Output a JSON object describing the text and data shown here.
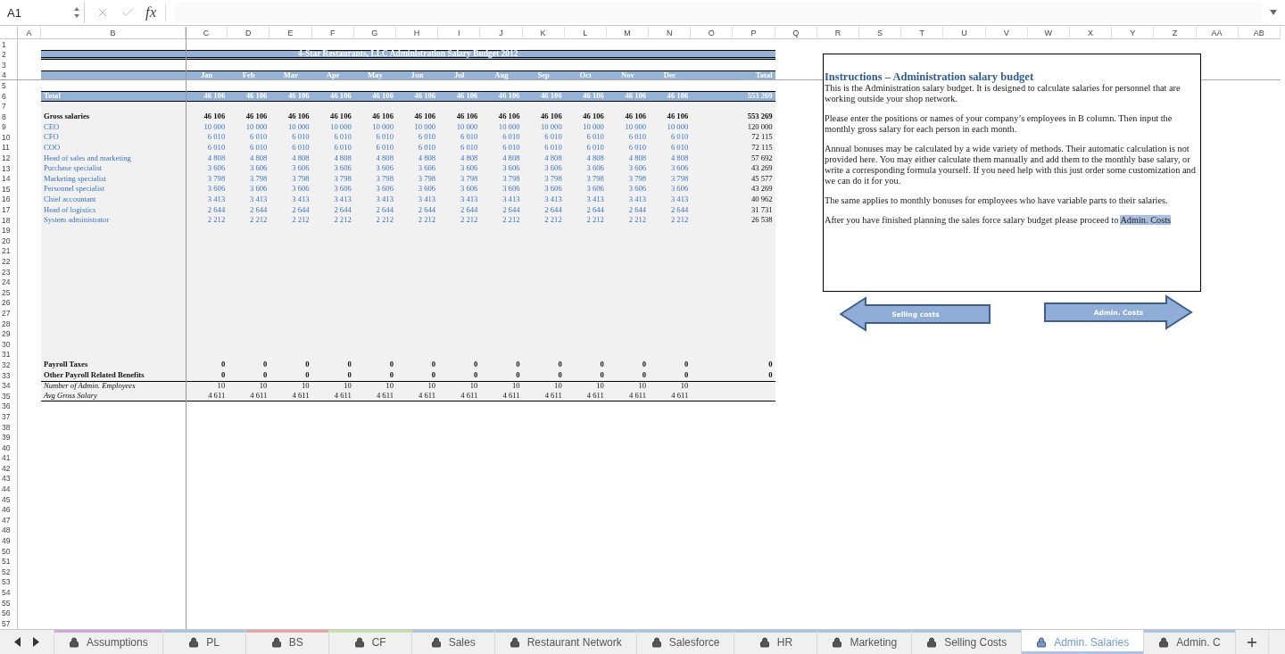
{
  "formula_bar": {
    "cell_ref": "A1",
    "function_symbol": "fx"
  },
  "columns": [
    "A",
    "B",
    "C",
    "D",
    "E",
    "F",
    "G",
    "H",
    "I",
    "J",
    "K",
    "L",
    "M",
    "N",
    "O",
    "P",
    "Q",
    "R",
    "S",
    "T",
    "U",
    "V",
    "W",
    "X",
    "Y",
    "Z",
    "AA",
    "AB"
  ],
  "row_numbers": [
    "1",
    "2",
    "3",
    "4",
    "5",
    "6",
    "7",
    "8",
    "9",
    "10",
    "11",
    "12",
    "13",
    "14",
    "15",
    "16",
    "17",
    "18",
    "19",
    "20",
    "21",
    "22",
    "23",
    "24",
    "25",
    "26",
    "27",
    "28",
    "29",
    "30",
    "31",
    "32",
    "33",
    "34",
    "35",
    "36",
    "37",
    "38",
    "39",
    "40",
    "41",
    "42",
    "43",
    "44",
    "45",
    "46",
    "47",
    "48",
    "49",
    "50",
    "51",
    "52",
    "53",
    "54",
    "55",
    "56",
    "57"
  ],
  "budget": {
    "title": "4-Star Restaurants, LLC Administration Salary Budget 2012",
    "months": [
      "Jan",
      "Feb",
      "Mar",
      "Apr",
      "May",
      "Jun",
      "Jul",
      "Aug",
      "Sep",
      "Oct",
      "Nov",
      "Dec"
    ],
    "total_header": "Total",
    "total_row": {
      "label": "Total",
      "values": [
        "46 106",
        "46 106",
        "46 106",
        "46 106",
        "46 106",
        "46 106",
        "46 106",
        "46 106",
        "46 106",
        "46 106",
        "46 106",
        "46 106"
      ],
      "total": "553 269"
    },
    "salary_rows": [
      {
        "kind": "bold",
        "label": "Gross salaries",
        "values": [
          "46 106",
          "46 106",
          "46 106",
          "46 106",
          "46 106",
          "46 106",
          "46 106",
          "46 106",
          "46 106",
          "46 106",
          "46 106",
          "46 106"
        ],
        "total": "553 269"
      },
      {
        "kind": "input",
        "label": "CEO",
        "values": [
          "10 000",
          "10 000",
          "10 000",
          "10 000",
          "10 000",
          "10 000",
          "10 000",
          "10 000",
          "10 000",
          "10 000",
          "10 000",
          "10 000"
        ],
        "total": "120 000"
      },
      {
        "kind": "input",
        "label": "CFO",
        "values": [
          "6 010",
          "6 010",
          "6 010",
          "6 010",
          "6 010",
          "6 010",
          "6 010",
          "6 010",
          "6 010",
          "6 010",
          "6 010",
          "6 010"
        ],
        "total": "72 115"
      },
      {
        "kind": "input",
        "label": "COO",
        "values": [
          "6 010",
          "6 010",
          "6 010",
          "6 010",
          "6 010",
          "6 010",
          "6 010",
          "6 010",
          "6 010",
          "6 010",
          "6 010",
          "6 010"
        ],
        "total": "72 115"
      },
      {
        "kind": "input",
        "label": "Head of sales and marketing",
        "values": [
          "4 808",
          "4 808",
          "4 808",
          "4 808",
          "4 808",
          "4 808",
          "4 808",
          "4 808",
          "4 808",
          "4 808",
          "4 808",
          "4 808"
        ],
        "total": "57 692"
      },
      {
        "kind": "input",
        "label": "Purchase specialist",
        "values": [
          "3 606",
          "3 606",
          "3 606",
          "3 606",
          "3 606",
          "3 606",
          "3 606",
          "3 606",
          "3 606",
          "3 606",
          "3 606",
          "3 606"
        ],
        "total": "43 269"
      },
      {
        "kind": "input",
        "label": "Marketing specialist",
        "values": [
          "3 798",
          "3 798",
          "3 798",
          "3 798",
          "3 798",
          "3 798",
          "3 798",
          "3 798",
          "3 798",
          "3 798",
          "3 798",
          "3 798"
        ],
        "total": "45 577"
      },
      {
        "kind": "input",
        "label": "Personnel specialist",
        "values": [
          "3 606",
          "3 606",
          "3 606",
          "3 606",
          "3 606",
          "3 606",
          "3 606",
          "3 606",
          "3 606",
          "3 606",
          "3 606",
          "3 606"
        ],
        "total": "43 269"
      },
      {
        "kind": "input",
        "label": "Chief accountant",
        "values": [
          "3 413",
          "3 413",
          "3 413",
          "3 413",
          "3 413",
          "3 413",
          "3 413",
          "3 413",
          "3 413",
          "3 413",
          "3 413",
          "3 413"
        ],
        "total": "40 962"
      },
      {
        "kind": "input",
        "label": "Head of logistics",
        "values": [
          "2 644",
          "2 644",
          "2 644",
          "2 644",
          "2 644",
          "2 644",
          "2 644",
          "2 644",
          "2 644",
          "2 644",
          "2 644",
          "2 644"
        ],
        "total": "31 731"
      },
      {
        "kind": "input",
        "label": "System administrator",
        "values": [
          "2 212",
          "2 212",
          "2 212",
          "2 212",
          "2 212",
          "2 212",
          "2 212",
          "2 212",
          "2 212",
          "2 212",
          "2 212",
          "2 212"
        ],
        "total": "26 538"
      }
    ],
    "footer_rows": [
      {
        "kind": "bold",
        "label": "Payroll Taxes",
        "values": [
          "0",
          "0",
          "0",
          "0",
          "0",
          "0",
          "0",
          "0",
          "0",
          "0",
          "0",
          "0"
        ],
        "total": "0"
      },
      {
        "kind": "bold",
        "label": "Other Payroll Related Benefits",
        "values": [
          "0",
          "0",
          "0",
          "0",
          "0",
          "0",
          "0",
          "0",
          "0",
          "0",
          "0",
          "0"
        ],
        "total": "0"
      },
      {
        "kind": "italic",
        "label": "Number of Admin. Employees",
        "values": [
          "10",
          "10",
          "10",
          "10",
          "10",
          "10",
          "10",
          "10",
          "10",
          "10",
          "10",
          "10"
        ]
      },
      {
        "kind": "italic",
        "label": "Avg Gross Salary",
        "values": [
          "4 611",
          "4 611",
          "4 611",
          "4 611",
          "4 611",
          "4 611",
          "4 611",
          "4 611",
          "4 611",
          "4 611",
          "4 611",
          "4 611"
        ]
      }
    ]
  },
  "instructions": {
    "title": "Instructions – Administration salary budget",
    "paragraphs": [
      "This is the Administration salary budget. It is designed to calculate salaries for personnel that are working outside your shop network.",
      "Please enter the positions or names of your company’s employees in B column. Then input the monthly gross salary for each person in each month.",
      "Annual bonuses may be calculated by a wide variety of methods. Their automatic calculation is not provided here. You may either calculate them manually and add them to the monthly base salary, or write a corresponding formula yourself. If you need help with this just order some customization and we can do it for you.",
      "The same applies to monthly bonuses for employees who have variable parts to their salaries."
    ],
    "closing": "After you have finished planning the sales force salary budget please proceed to",
    "closing_link": "Admin. Costs"
  },
  "nav_buttons": [
    {
      "kind": "back",
      "label": "Selling costs"
    },
    {
      "kind": "forward",
      "label": "Admin. Costs"
    }
  ],
  "sheet_tabs": [
    {
      "label": "Assumptions",
      "selected": false,
      "color": "#cfa9d8"
    },
    {
      "label": "PL",
      "selected": false,
      "color": "#aec3e2"
    },
    {
      "label": "BS",
      "selected": false,
      "color": "#e8a4a4"
    },
    {
      "label": "CF",
      "selected": false,
      "color": "#c7e0a8"
    },
    {
      "label": "Sales",
      "selected": false,
      "color": "#aec3e2"
    },
    {
      "label": "Restaurant Network",
      "selected": false,
      "color": "#aec3e2"
    },
    {
      "label": "Salesforce",
      "selected": false,
      "color": "#aec3e2"
    },
    {
      "label": "HR",
      "selected": false,
      "color": "#aec3e2"
    },
    {
      "label": "Marketing",
      "selected": false,
      "color": "#aec3e2"
    },
    {
      "label": "Selling Costs",
      "selected": false,
      "color": "#aec3e2"
    },
    {
      "label": "Admin. Salaries",
      "selected": true,
      "color": "#aec3e2"
    },
    {
      "label": "Admin. C",
      "selected": false,
      "color": "#aec3e2"
    }
  ]
}
